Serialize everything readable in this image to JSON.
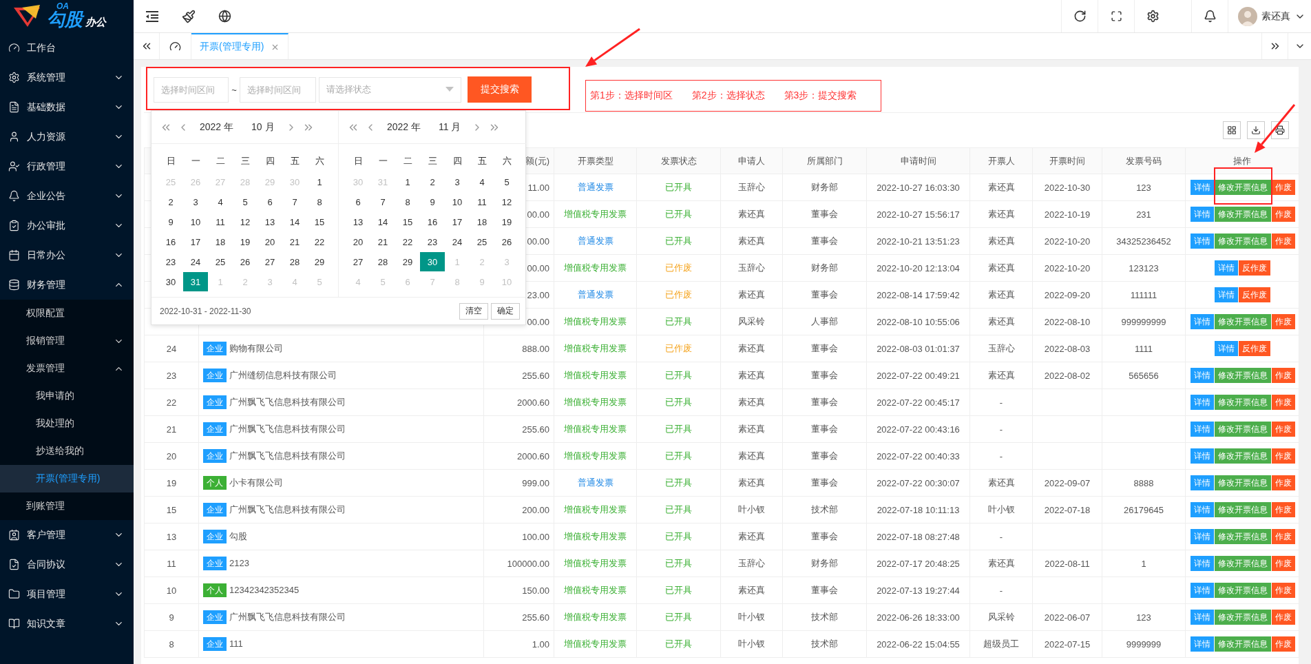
{
  "logo": {
    "badge": "OA",
    "name": "勾股",
    "suffix": "办公"
  },
  "sidebar": {
    "items": [
      {
        "label": "工作台",
        "selected": false
      },
      {
        "label": "系统管理",
        "selected": false,
        "expanded": false
      },
      {
        "label": "基础数据",
        "selected": false,
        "expanded": false
      },
      {
        "label": "人力资源",
        "selected": false,
        "expanded": false
      },
      {
        "label": "行政管理",
        "selected": false,
        "expanded": false
      },
      {
        "label": "企业公告",
        "selected": false,
        "expanded": false
      },
      {
        "label": "办公审批",
        "selected": false,
        "expanded": false
      },
      {
        "label": "日常办公",
        "selected": false,
        "expanded": false
      },
      {
        "label": "财务管理",
        "selected": false,
        "expanded": true,
        "children": [
          {
            "label": "权限配置",
            "selected": false
          },
          {
            "label": "报销管理",
            "selected": false,
            "expanded": false
          },
          {
            "label": "发票管理",
            "selected": false,
            "expanded": true,
            "children": [
              {
                "label": "我申请的",
                "selected": false
              },
              {
                "label": "我处理的",
                "selected": false
              },
              {
                "label": "抄送给我的",
                "selected": false
              },
              {
                "label": "开票(管理专用)",
                "selected": true
              }
            ]
          },
          {
            "label": "到账管理",
            "selected": false
          }
        ]
      },
      {
        "label": "客户管理",
        "selected": false,
        "expanded": false
      },
      {
        "label": "合同协议",
        "selected": false,
        "expanded": false
      },
      {
        "label": "项目管理",
        "selected": false,
        "expanded": false
      },
      {
        "label": "知识文章",
        "selected": false,
        "expanded": false
      }
    ]
  },
  "header": {
    "user": "素还真"
  },
  "tabs": [
    {
      "label": "开票(管理专用)",
      "selected": true
    }
  ],
  "search": {
    "start_placeholder": "选择时间区间",
    "separator": "~",
    "end_placeholder": "选择时间区间",
    "status_placeholder": "请选择状态",
    "submit": "提交搜索"
  },
  "steps": [
    "第1步：选择时间区",
    "第2步：选择状态",
    "第3步：提交搜索"
  ],
  "calendar": {
    "panels": [
      {
        "year": "2022 年",
        "month": "10 月",
        "weekdays": [
          "日",
          "一",
          "二",
          "三",
          "四",
          "五",
          "六"
        ],
        "days": [
          {
            "d": "25",
            "muted": true,
            "selected": false
          },
          {
            "d": "26",
            "muted": true,
            "selected": false
          },
          {
            "d": "27",
            "muted": true,
            "selected": false
          },
          {
            "d": "28",
            "muted": true,
            "selected": false
          },
          {
            "d": "29",
            "muted": true,
            "selected": false
          },
          {
            "d": "30",
            "muted": true,
            "selected": false
          },
          {
            "d": "1",
            "muted": false,
            "selected": false
          },
          {
            "d": "2",
            "muted": false,
            "selected": false
          },
          {
            "d": "3",
            "muted": false,
            "selected": false
          },
          {
            "d": "4",
            "muted": false,
            "selected": false
          },
          {
            "d": "5",
            "muted": false,
            "selected": false
          },
          {
            "d": "6",
            "muted": false,
            "selected": false
          },
          {
            "d": "7",
            "muted": false,
            "selected": false
          },
          {
            "d": "8",
            "muted": false,
            "selected": false
          },
          {
            "d": "9",
            "muted": false,
            "selected": false
          },
          {
            "d": "10",
            "muted": false,
            "selected": false
          },
          {
            "d": "11",
            "muted": false,
            "selected": false
          },
          {
            "d": "12",
            "muted": false,
            "selected": false
          },
          {
            "d": "13",
            "muted": false,
            "selected": false
          },
          {
            "d": "14",
            "muted": false,
            "selected": false
          },
          {
            "d": "15",
            "muted": false,
            "selected": false
          },
          {
            "d": "16",
            "muted": false,
            "selected": false
          },
          {
            "d": "17",
            "muted": false,
            "selected": false
          },
          {
            "d": "18",
            "muted": false,
            "selected": false
          },
          {
            "d": "19",
            "muted": false,
            "selected": false
          },
          {
            "d": "20",
            "muted": false,
            "selected": false
          },
          {
            "d": "21",
            "muted": false,
            "selected": false
          },
          {
            "d": "22",
            "muted": false,
            "selected": false
          },
          {
            "d": "23",
            "muted": false,
            "selected": false
          },
          {
            "d": "24",
            "muted": false,
            "selected": false
          },
          {
            "d": "25",
            "muted": false,
            "selected": false
          },
          {
            "d": "26",
            "muted": false,
            "selected": false
          },
          {
            "d": "27",
            "muted": false,
            "selected": false
          },
          {
            "d": "28",
            "muted": false,
            "selected": false
          },
          {
            "d": "29",
            "muted": false,
            "selected": false
          },
          {
            "d": "30",
            "muted": false,
            "selected": false
          },
          {
            "d": "31",
            "muted": false,
            "selected": true
          },
          {
            "d": "1",
            "muted": true,
            "selected": false
          },
          {
            "d": "2",
            "muted": true,
            "selected": false
          },
          {
            "d": "3",
            "muted": true,
            "selected": false
          },
          {
            "d": "4",
            "muted": true,
            "selected": false
          },
          {
            "d": "5",
            "muted": true,
            "selected": false
          }
        ]
      },
      {
        "year": "2022 年",
        "month": "11 月",
        "weekdays": [
          "日",
          "一",
          "二",
          "三",
          "四",
          "五",
          "六"
        ],
        "days": [
          {
            "d": "30",
            "muted": true,
            "selected": false
          },
          {
            "d": "31",
            "muted": true,
            "selected": false
          },
          {
            "d": "1",
            "muted": false,
            "selected": false
          },
          {
            "d": "2",
            "muted": false,
            "selected": false
          },
          {
            "d": "3",
            "muted": false,
            "selected": false
          },
          {
            "d": "4",
            "muted": false,
            "selected": false
          },
          {
            "d": "5",
            "muted": false,
            "selected": false
          },
          {
            "d": "6",
            "muted": false,
            "selected": false
          },
          {
            "d": "7",
            "muted": false,
            "selected": false
          },
          {
            "d": "8",
            "muted": false,
            "selected": false
          },
          {
            "d": "9",
            "muted": false,
            "selected": false
          },
          {
            "d": "10",
            "muted": false,
            "selected": false
          },
          {
            "d": "11",
            "muted": false,
            "selected": false
          },
          {
            "d": "12",
            "muted": false,
            "selected": false
          },
          {
            "d": "13",
            "muted": false,
            "selected": false
          },
          {
            "d": "14",
            "muted": false,
            "selected": false
          },
          {
            "d": "15",
            "muted": false,
            "selected": false
          },
          {
            "d": "16",
            "muted": false,
            "selected": false
          },
          {
            "d": "17",
            "muted": false,
            "selected": false
          },
          {
            "d": "18",
            "muted": false,
            "selected": false
          },
          {
            "d": "19",
            "muted": false,
            "selected": false
          },
          {
            "d": "20",
            "muted": false,
            "selected": false
          },
          {
            "d": "21",
            "muted": false,
            "selected": false
          },
          {
            "d": "22",
            "muted": false,
            "selected": false
          },
          {
            "d": "23",
            "muted": false,
            "selected": false
          },
          {
            "d": "24",
            "muted": false,
            "selected": false
          },
          {
            "d": "25",
            "muted": false,
            "selected": false
          },
          {
            "d": "26",
            "muted": false,
            "selected": false
          },
          {
            "d": "27",
            "muted": false,
            "selected": false
          },
          {
            "d": "28",
            "muted": false,
            "selected": false
          },
          {
            "d": "29",
            "muted": false,
            "selected": false
          },
          {
            "d": "30",
            "muted": false,
            "selected": true
          },
          {
            "d": "1",
            "muted": true,
            "selected": false
          },
          {
            "d": "2",
            "muted": true,
            "selected": false
          },
          {
            "d": "3",
            "muted": true,
            "selected": false
          },
          {
            "d": "4",
            "muted": true,
            "selected": false
          },
          {
            "d": "5",
            "muted": true,
            "selected": false
          },
          {
            "d": "6",
            "muted": true,
            "selected": false
          },
          {
            "d": "7",
            "muted": true,
            "selected": false
          },
          {
            "d": "8",
            "muted": true,
            "selected": false
          },
          {
            "d": "9",
            "muted": true,
            "selected": false
          },
          {
            "d": "10",
            "muted": true,
            "selected": false
          }
        ]
      }
    ],
    "range": "2022-10-31 - 2022-11-30",
    "buttons": [
      "清空",
      "确定"
    ]
  },
  "table": {
    "columns": [
      "额(元)",
      "开票类型",
      "发票状态",
      "申请人",
      "所属部门",
      "申请时间",
      "开票人",
      "开票时间",
      "发票号码",
      "操作"
    ],
    "rows": [
      {
        "amount": "11.00",
        "type": {
          "text": "普通发票",
          "color": "#1e88e5"
        },
        "status": {
          "text": "已开具",
          "color": "#3cb035"
        },
        "applicant": "玉辞心",
        "department": "财务部",
        "applied_at": "2022-10-27 16:03:30",
        "issuer": "素还真",
        "issued_on": "2022-10-30",
        "invoice_no": "123",
        "actions": [
          {
            "label": "详情",
            "kind": "detail"
          },
          {
            "label": "修改开票信息",
            "kind": "edit"
          },
          {
            "label": "作废",
            "kind": "void"
          }
        ]
      },
      {
        "amount": "00.00",
        "type": {
          "text": "增值税专用发票",
          "color": "#3cb035"
        },
        "status": {
          "text": "已开具",
          "color": "#3cb035"
        },
        "applicant": "素还真",
        "department": "董事会",
        "applied_at": "2022-10-27 15:56:17",
        "issuer": "素还真",
        "issued_on": "2022-10-19",
        "invoice_no": "231",
        "actions": [
          {
            "label": "详情",
            "kind": "detail"
          },
          {
            "label": "修改开票信息",
            "kind": "edit"
          },
          {
            "label": "作废",
            "kind": "void"
          }
        ]
      },
      {
        "amount": "00.00",
        "type": {
          "text": "普通发票",
          "color": "#1e88e5"
        },
        "status": {
          "text": "已开具",
          "color": "#3cb035"
        },
        "applicant": "素还真",
        "department": "董事会",
        "applied_at": "2022-10-21 13:51:23",
        "issuer": "素还真",
        "issued_on": "2022-10-20",
        "invoice_no": "34325236452",
        "actions": [
          {
            "label": "详情",
            "kind": "detail"
          },
          {
            "label": "修改开票信息",
            "kind": "edit"
          },
          {
            "label": "作废",
            "kind": "void"
          }
        ]
      },
      {
        "amount": "00.00",
        "type": {
          "text": "增值税专用发票",
          "color": "#3cb035"
        },
        "status": {
          "text": "已作废",
          "color": "#f5a623"
        },
        "applicant": "玉辞心",
        "department": "财务部",
        "applied_at": "2022-10-20 12:13:04",
        "issuer": "素还真",
        "issued_on": "2022-10-20",
        "invoice_no": "123123",
        "actions": [
          {
            "label": "详情",
            "kind": "detail"
          },
          {
            "label": "反作废",
            "kind": "unvoid"
          }
        ]
      },
      {
        "amount": "23.00",
        "type": {
          "text": "普通发票",
          "color": "#1e88e5"
        },
        "status": {
          "text": "已作废",
          "color": "#f5a623"
        },
        "applicant": "素还真",
        "department": "董事会",
        "applied_at": "2022-08-14 17:59:42",
        "issuer": "素还真",
        "issued_on": "2022-09-20",
        "invoice_no": "111111",
        "actions": [
          {
            "label": "详情",
            "kind": "detail"
          },
          {
            "label": "反作废",
            "kind": "unvoid"
          }
        ]
      },
      {
        "amount": "00.00",
        "type": {
          "text": "增值税专用发票",
          "color": "#3cb035"
        },
        "status": {
          "text": "已开具",
          "color": "#3cb035"
        },
        "applicant": "风采铃",
        "department": "人事部",
        "applied_at": "2022-08-10 10:55:06",
        "issuer": "素还真",
        "issued_on": "2022-08-10",
        "invoice_no": "999999999",
        "actions": [
          {
            "label": "详情",
            "kind": "detail"
          },
          {
            "label": "修改开票信息",
            "kind": "edit"
          },
          {
            "label": "作废",
            "kind": "void"
          }
        ]
      },
      {
        "id": "24",
        "customer": {
          "tag": "企业",
          "color": "#1e9fff",
          "name": "购物有限公司"
        },
        "amount": "888.00",
        "type": {
          "text": "增值税专用发票",
          "color": "#3cb035"
        },
        "status": {
          "text": "已作废",
          "color": "#f5a623"
        },
        "applicant": "素还真",
        "department": "董事会",
        "applied_at": "2022-08-03 01:01:37",
        "issuer": "玉辞心",
        "issued_on": "2022-08-03",
        "invoice_no": "1111",
        "actions": [
          {
            "label": "详情",
            "kind": "detail"
          },
          {
            "label": "反作废",
            "kind": "unvoid"
          }
        ]
      },
      {
        "id": "23",
        "customer": {
          "tag": "企业",
          "color": "#1e9fff",
          "name": "广州缝纫信息科技有限公司"
        },
        "amount": "255.60",
        "type": {
          "text": "增值税专用发票",
          "color": "#3cb035"
        },
        "status": {
          "text": "已开具",
          "color": "#3cb035"
        },
        "applicant": "素还真",
        "department": "董事会",
        "applied_at": "2022-07-22 00:49:21",
        "issuer": "素还真",
        "issued_on": "2022-08-02",
        "invoice_no": "565656",
        "actions": [
          {
            "label": "详情",
            "kind": "detail"
          },
          {
            "label": "修改开票信息",
            "kind": "edit"
          },
          {
            "label": "作废",
            "kind": "void"
          }
        ]
      },
      {
        "id": "22",
        "customer": {
          "tag": "企业",
          "color": "#1e9fff",
          "name": "广州飘飞飞信息科技有限公司"
        },
        "amount": "2000.60",
        "type": {
          "text": "增值税专用发票",
          "color": "#3cb035"
        },
        "status": {
          "text": "已开具",
          "color": "#3cb035"
        },
        "applicant": "素还真",
        "department": "董事会",
        "applied_at": "2022-07-22 00:45:17",
        "issuer": "-",
        "actions": [
          {
            "label": "详情",
            "kind": "detail"
          },
          {
            "label": "修改开票信息",
            "kind": "edit"
          },
          {
            "label": "作废",
            "kind": "void"
          }
        ]
      },
      {
        "id": "21",
        "customer": {
          "tag": "企业",
          "color": "#1e9fff",
          "name": "广州飘飞飞信息科技有限公司"
        },
        "amount": "255.60",
        "type": {
          "text": "增值税专用发票",
          "color": "#3cb035"
        },
        "status": {
          "text": "已开具",
          "color": "#3cb035"
        },
        "applicant": "素还真",
        "department": "董事会",
        "applied_at": "2022-07-22 00:43:16",
        "issuer": "-",
        "actions": [
          {
            "label": "详情",
            "kind": "detail"
          },
          {
            "label": "修改开票信息",
            "kind": "edit"
          },
          {
            "label": "作废",
            "kind": "void"
          }
        ]
      },
      {
        "id": "20",
        "customer": {
          "tag": "企业",
          "color": "#1e9fff",
          "name": "广州飘飞飞信息科技有限公司"
        },
        "amount": "2000.60",
        "type": {
          "text": "增值税专用发票",
          "color": "#3cb035"
        },
        "status": {
          "text": "已开具",
          "color": "#3cb035"
        },
        "applicant": "素还真",
        "department": "董事会",
        "applied_at": "2022-07-22 00:40:33",
        "issuer": "-",
        "actions": [
          {
            "label": "详情",
            "kind": "detail"
          },
          {
            "label": "修改开票信息",
            "kind": "edit"
          },
          {
            "label": "作废",
            "kind": "void"
          }
        ]
      },
      {
        "id": "19",
        "customer": {
          "tag": "个人",
          "color": "#3cb035",
          "name": "小卡有限公司"
        },
        "amount": "999.00",
        "type": {
          "text": "普通发票",
          "color": "#1e88e5"
        },
        "status": {
          "text": "已开具",
          "color": "#3cb035"
        },
        "applicant": "素还真",
        "department": "董事会",
        "applied_at": "2022-07-22 00:30:07",
        "issuer": "素还真",
        "issued_on": "2022-09-07",
        "invoice_no": "8888",
        "actions": [
          {
            "label": "详情",
            "kind": "detail"
          },
          {
            "label": "修改开票信息",
            "kind": "edit"
          },
          {
            "label": "作废",
            "kind": "void"
          }
        ]
      },
      {
        "id": "15",
        "customer": {
          "tag": "企业",
          "color": "#1e9fff",
          "name": "广州飘飞飞信息科技有限公司"
        },
        "amount": "200.00",
        "type": {
          "text": "增值税专用发票",
          "color": "#3cb035"
        },
        "status": {
          "text": "已开具",
          "color": "#3cb035"
        },
        "applicant": "叶小钗",
        "department": "技术部",
        "applied_at": "2022-07-18 10:11:13",
        "issuer": "叶小钗",
        "issued_on": "2022-07-18",
        "invoice_no": "26179645",
        "actions": [
          {
            "label": "详情",
            "kind": "detail"
          },
          {
            "label": "修改开票信息",
            "kind": "edit"
          },
          {
            "label": "作废",
            "kind": "void"
          }
        ]
      },
      {
        "id": "13",
        "customer": {
          "tag": "企业",
          "color": "#1e9fff",
          "name": "勾股"
        },
        "amount": "100.00",
        "type": {
          "text": "增值税专用发票",
          "color": "#3cb035"
        },
        "status": {
          "text": "已开具",
          "color": "#3cb035"
        },
        "applicant": "素还真",
        "department": "董事会",
        "applied_at": "2022-07-18 08:27:48",
        "issuer": "-",
        "actions": [
          {
            "label": "详情",
            "kind": "detail"
          },
          {
            "label": "修改开票信息",
            "kind": "edit"
          },
          {
            "label": "作废",
            "kind": "void"
          }
        ]
      },
      {
        "id": "11",
        "customer": {
          "tag": "企业",
          "color": "#1e9fff",
          "name": "2123"
        },
        "amount": "100000.00",
        "type": {
          "text": "增值税专用发票",
          "color": "#3cb035"
        },
        "status": {
          "text": "已开具",
          "color": "#3cb035"
        },
        "applicant": "玉辞心",
        "department": "财务部",
        "applied_at": "2022-07-17 20:48:25",
        "issuer": "素还真",
        "issued_on": "2022-08-11",
        "invoice_no": "1",
        "actions": [
          {
            "label": "详情",
            "kind": "detail"
          },
          {
            "label": "修改开票信息",
            "kind": "edit"
          },
          {
            "label": "作废",
            "kind": "void"
          }
        ]
      },
      {
        "id": "10",
        "customer": {
          "tag": "个人",
          "color": "#3cb035",
          "name": "12342342352345"
        },
        "amount": "150.00",
        "type": {
          "text": "增值税专用发票",
          "color": "#3cb035"
        },
        "status": {
          "text": "已开具",
          "color": "#3cb035"
        },
        "applicant": "素还真",
        "department": "董事会",
        "applied_at": "2022-07-13 19:27:44",
        "issuer": "-",
        "actions": [
          {
            "label": "详情",
            "kind": "detail"
          },
          {
            "label": "修改开票信息",
            "kind": "edit"
          },
          {
            "label": "作废",
            "kind": "void"
          }
        ]
      },
      {
        "id": "9",
        "customer": {
          "tag": "企业",
          "color": "#1e9fff",
          "name": "广州飘飞飞信息科技有限公司"
        },
        "amount": "255.60",
        "type": {
          "text": "增值税专用发票",
          "color": "#3cb035"
        },
        "status": {
          "text": "已开具",
          "color": "#3cb035"
        },
        "applicant": "叶小钗",
        "department": "技术部",
        "applied_at": "2022-06-26 18:33:00",
        "issuer": "风采铃",
        "issued_on": "2022-06-07",
        "invoice_no": "123",
        "actions": [
          {
            "label": "详情",
            "kind": "detail"
          },
          {
            "label": "修改开票信息",
            "kind": "edit"
          },
          {
            "label": "作废",
            "kind": "void"
          }
        ]
      },
      {
        "id": "8",
        "customer": {
          "tag": "企业",
          "color": "#1e9fff",
          "name": "111"
        },
        "amount": "1.00",
        "type": {
          "text": "增值税专用发票",
          "color": "#3cb035"
        },
        "status": {
          "text": "已开具",
          "color": "#3cb035"
        },
        "applicant": "叶小钗",
        "department": "技术部",
        "applied_at": "2022-06-22 15:04:55",
        "issuer": "超级员工",
        "issued_on": "2022-07-15",
        "invoice_no": "9999999",
        "actions": [
          {
            "label": "详情",
            "kind": "detail"
          },
          {
            "label": "修改开票信息",
            "kind": "edit"
          },
          {
            "label": "作废",
            "kind": "void"
          }
        ]
      }
    ]
  }
}
